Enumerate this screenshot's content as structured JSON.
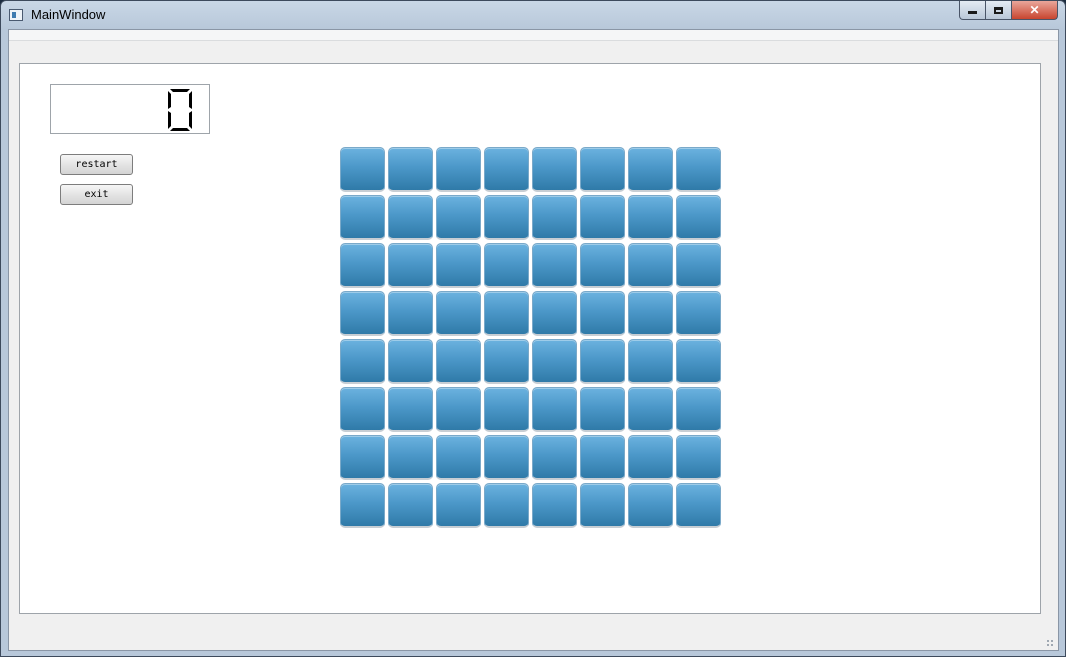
{
  "window": {
    "title": "MainWindow",
    "controls": {
      "minimize": "minimize",
      "maximize": "maximize",
      "close": "close"
    }
  },
  "lcd": {
    "value": "0"
  },
  "buttons": {
    "restart": "restart",
    "exit": "exit"
  },
  "board": {
    "rows": 8,
    "cols": 8,
    "tile_color": "#4c98c9"
  },
  "colors": {
    "accent": "#4c98c9",
    "close": "#c8452f"
  }
}
